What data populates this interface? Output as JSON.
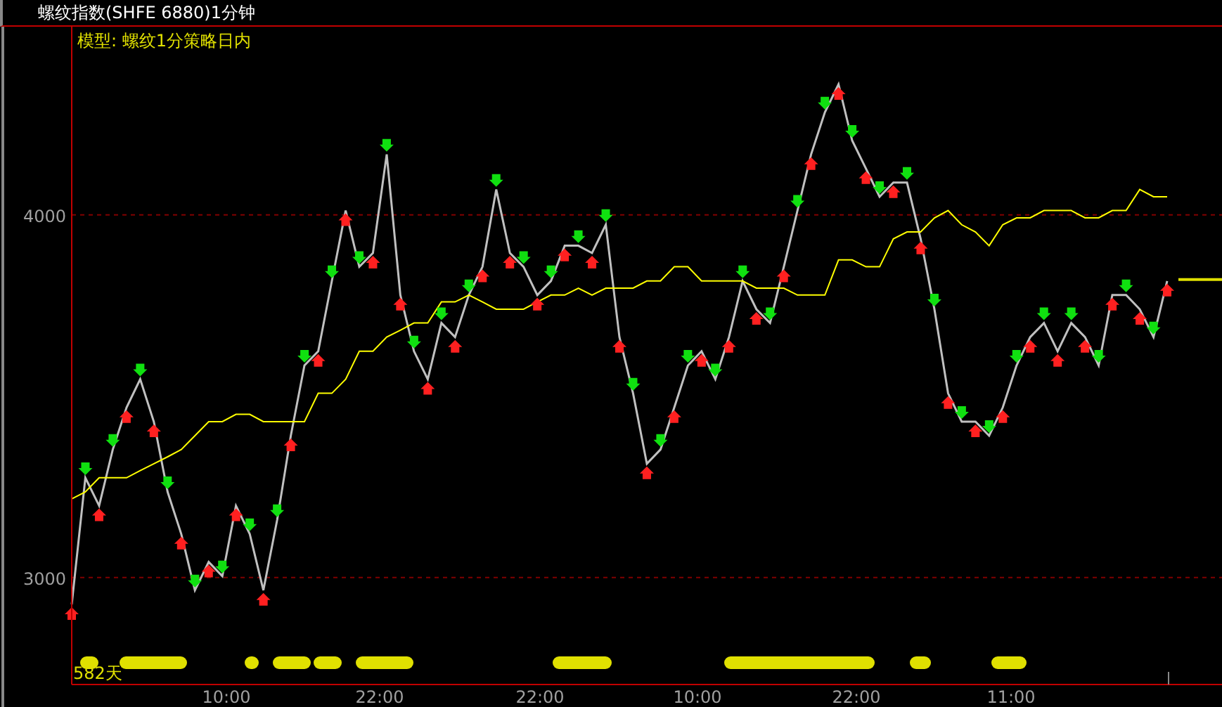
{
  "window": {
    "title": "螺纹指数(SHFE 6880)1分钟"
  },
  "chart": {
    "model_label": "模型: 螺纹1分策略日内",
    "bar_count_label": "582天",
    "x_axis_labels": [
      "10:00",
      "22:00",
      "22:00",
      "10:00",
      "22:00",
      "11:00"
    ],
    "chart_data": {
      "type": "line",
      "ylim": [
        2705,
        4519
      ],
      "yticks": [
        3000,
        4000
      ],
      "series": [
        {
          "color": "#c0c0c0",
          "values": [
            2926,
            3275,
            3198,
            3353,
            3469,
            3547,
            3430,
            3236,
            3120,
            2965,
            3043,
            3004,
            3198,
            3120,
            2965,
            3159,
            3391,
            3585,
            3624,
            3818,
            4012,
            3857,
            3895,
            4167,
            3779,
            3624,
            3547,
            3702,
            3663,
            3779,
            3857,
            4070,
            3895,
            3857,
            3779,
            3818,
            3915,
            3915,
            3895,
            3973,
            3663,
            3508,
            3314,
            3353,
            3469,
            3585,
            3624,
            3547,
            3663,
            3818,
            3740,
            3702,
            3857,
            4012,
            4167,
            4283,
            4360,
            4205,
            4128,
            4050,
            4089,
            4089,
            3934,
            3740,
            3508,
            3430,
            3430,
            3391,
            3469,
            3585,
            3663,
            3702,
            3624,
            3702,
            3663,
            3585,
            3779,
            3779,
            3740,
            3663,
            3818
          ]
        },
        {
          "color": "#ffff00",
          "values": [
            3217,
            3236,
            3275,
            3275,
            3275,
            3295,
            3314,
            3333,
            3353,
            3391,
            3430,
            3430,
            3450,
            3450,
            3430,
            3430,
            3430,
            3430,
            3508,
            3508,
            3547,
            3624,
            3624,
            3663,
            3682,
            3702,
            3702,
            3760,
            3760,
            3779,
            3760,
            3740,
            3740,
            3740,
            3760,
            3779,
            3779,
            3798,
            3779,
            3798,
            3798,
            3798,
            3818,
            3818,
            3857,
            3857,
            3818,
            3818,
            3818,
            3818,
            3798,
            3798,
            3798,
            3779,
            3779,
            3779,
            3876,
            3876,
            3857,
            3857,
            3934,
            3953,
            3953,
            3992,
            4012,
            3973,
            3953,
            3915,
            3973,
            3992,
            3992,
            4012,
            4012,
            4012,
            3992,
            3992,
            4012,
            4012,
            4070,
            4050,
            4050
          ]
        }
      ]
    }
  }
}
